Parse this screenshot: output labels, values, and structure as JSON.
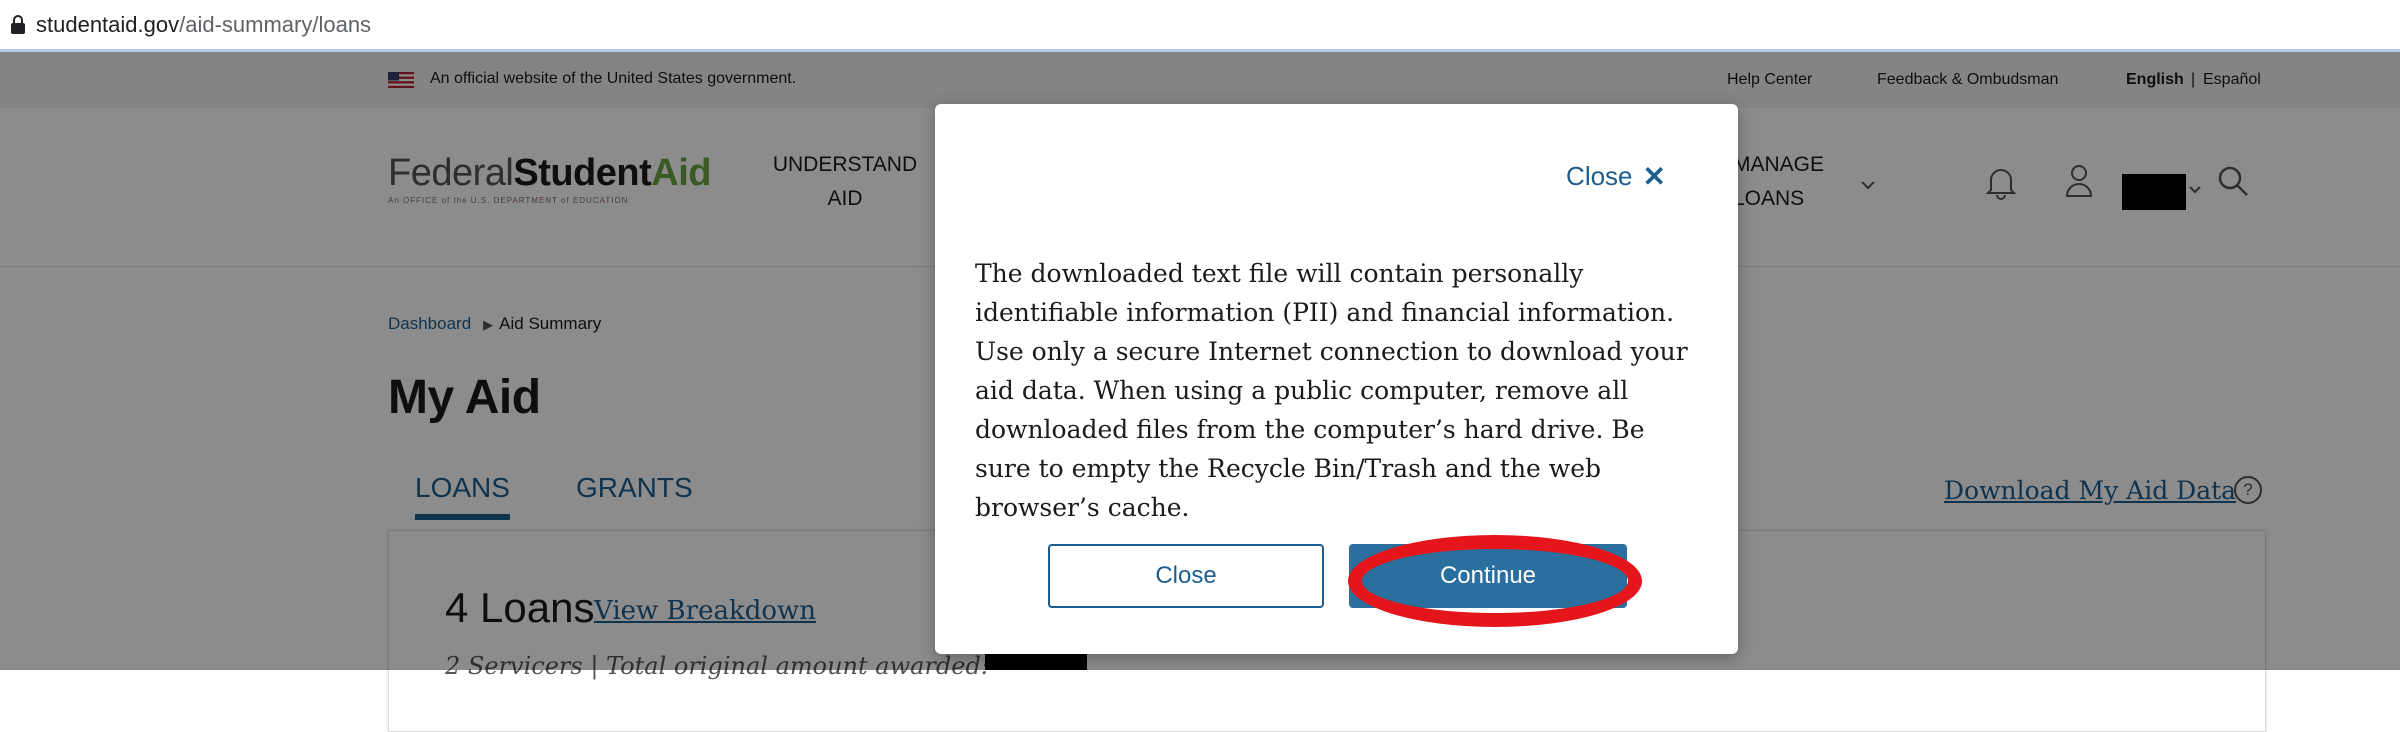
{
  "browser": {
    "url_host": "studentaid.gov",
    "url_path": "/aid-summary/loans"
  },
  "gov_banner": {
    "official_text": "An official website of the United States government.",
    "help_center": "Help Center",
    "feedback": "Feedback & Ombudsman",
    "english": "English",
    "divider": "|",
    "espanol": "Español"
  },
  "logo": {
    "federal": "Federal",
    "student": "Student",
    "aid": "Aid",
    "tagline": "An OFFICE of the U.S. DEPARTMENT of EDUCATION"
  },
  "nav": {
    "understand_line1": "UNDERSTAND",
    "understand_line2": "AID",
    "manage_line1": "MANAGE",
    "manage_line2": "LOANS"
  },
  "breadcrumb": {
    "dashboard": "Dashboard",
    "current": "Aid Summary"
  },
  "page": {
    "title": "My Aid",
    "tabs": [
      "LOANS",
      "GRANTS"
    ],
    "download_link": "Download My Aid Data",
    "help": "?"
  },
  "summary": {
    "loans_count": "4 Loans",
    "view_breakdown": "View Breakdown",
    "servicers_text": "2 Servicers | Total original amount awarded:"
  },
  "modal": {
    "close_label": "Close",
    "close_x": "✕",
    "body": "The downloaded text file will contain personally identifiable information (PII) and financial information. Use only a secure Internet connection to download your aid data. When using a public computer, remove all downloaded files from the computer’s hard drive. Be sure to empty the Recycle Bin/Trash and the web browser’s cache.",
    "close_button": "Close",
    "continue_button": "Continue"
  },
  "colors": {
    "link_blue": "#1e5e8e",
    "button_blue": "#2a6f9e",
    "aid_green": "#6aa543",
    "annotation_red": "#e4161b"
  }
}
